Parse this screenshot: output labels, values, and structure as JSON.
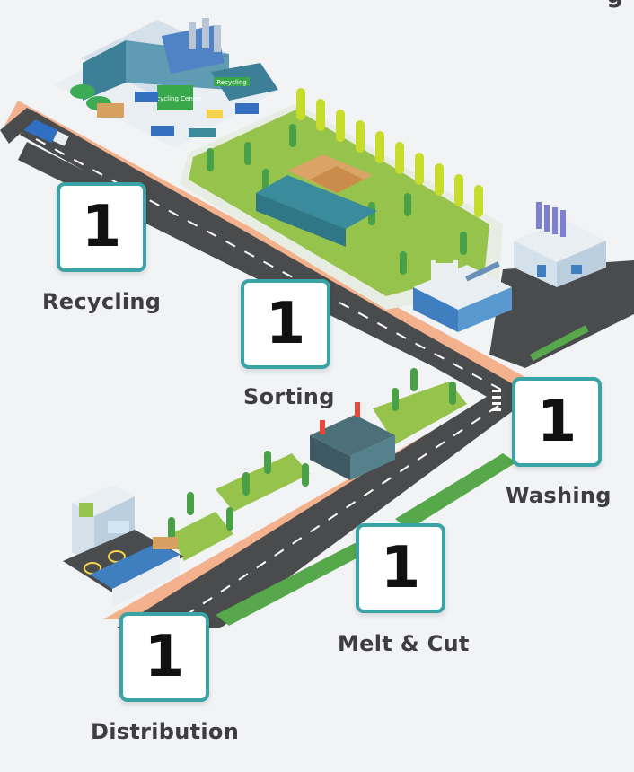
{
  "top_corner_text": "g",
  "stages": [
    {
      "id": "recycling",
      "label": "Recycling",
      "value": "1"
    },
    {
      "id": "sorting",
      "label": "Sorting",
      "value": "1"
    },
    {
      "id": "washing",
      "label": "Washing",
      "value": "1"
    },
    {
      "id": "melt_cut",
      "label": "Melt & Cut",
      "value": "1"
    },
    {
      "id": "distribution",
      "label": "Distribution",
      "value": "1"
    }
  ],
  "buildings": {
    "recycling_centre_sign": "Recycling Centre",
    "side_sign": "Recycling"
  },
  "colors": {
    "background": "#f2f3f5",
    "road": "#474849",
    "road_edge": "#f3b28d",
    "grass": "#96c34c",
    "card_border": "#39a3a6",
    "label_text": "#3e3e40"
  }
}
